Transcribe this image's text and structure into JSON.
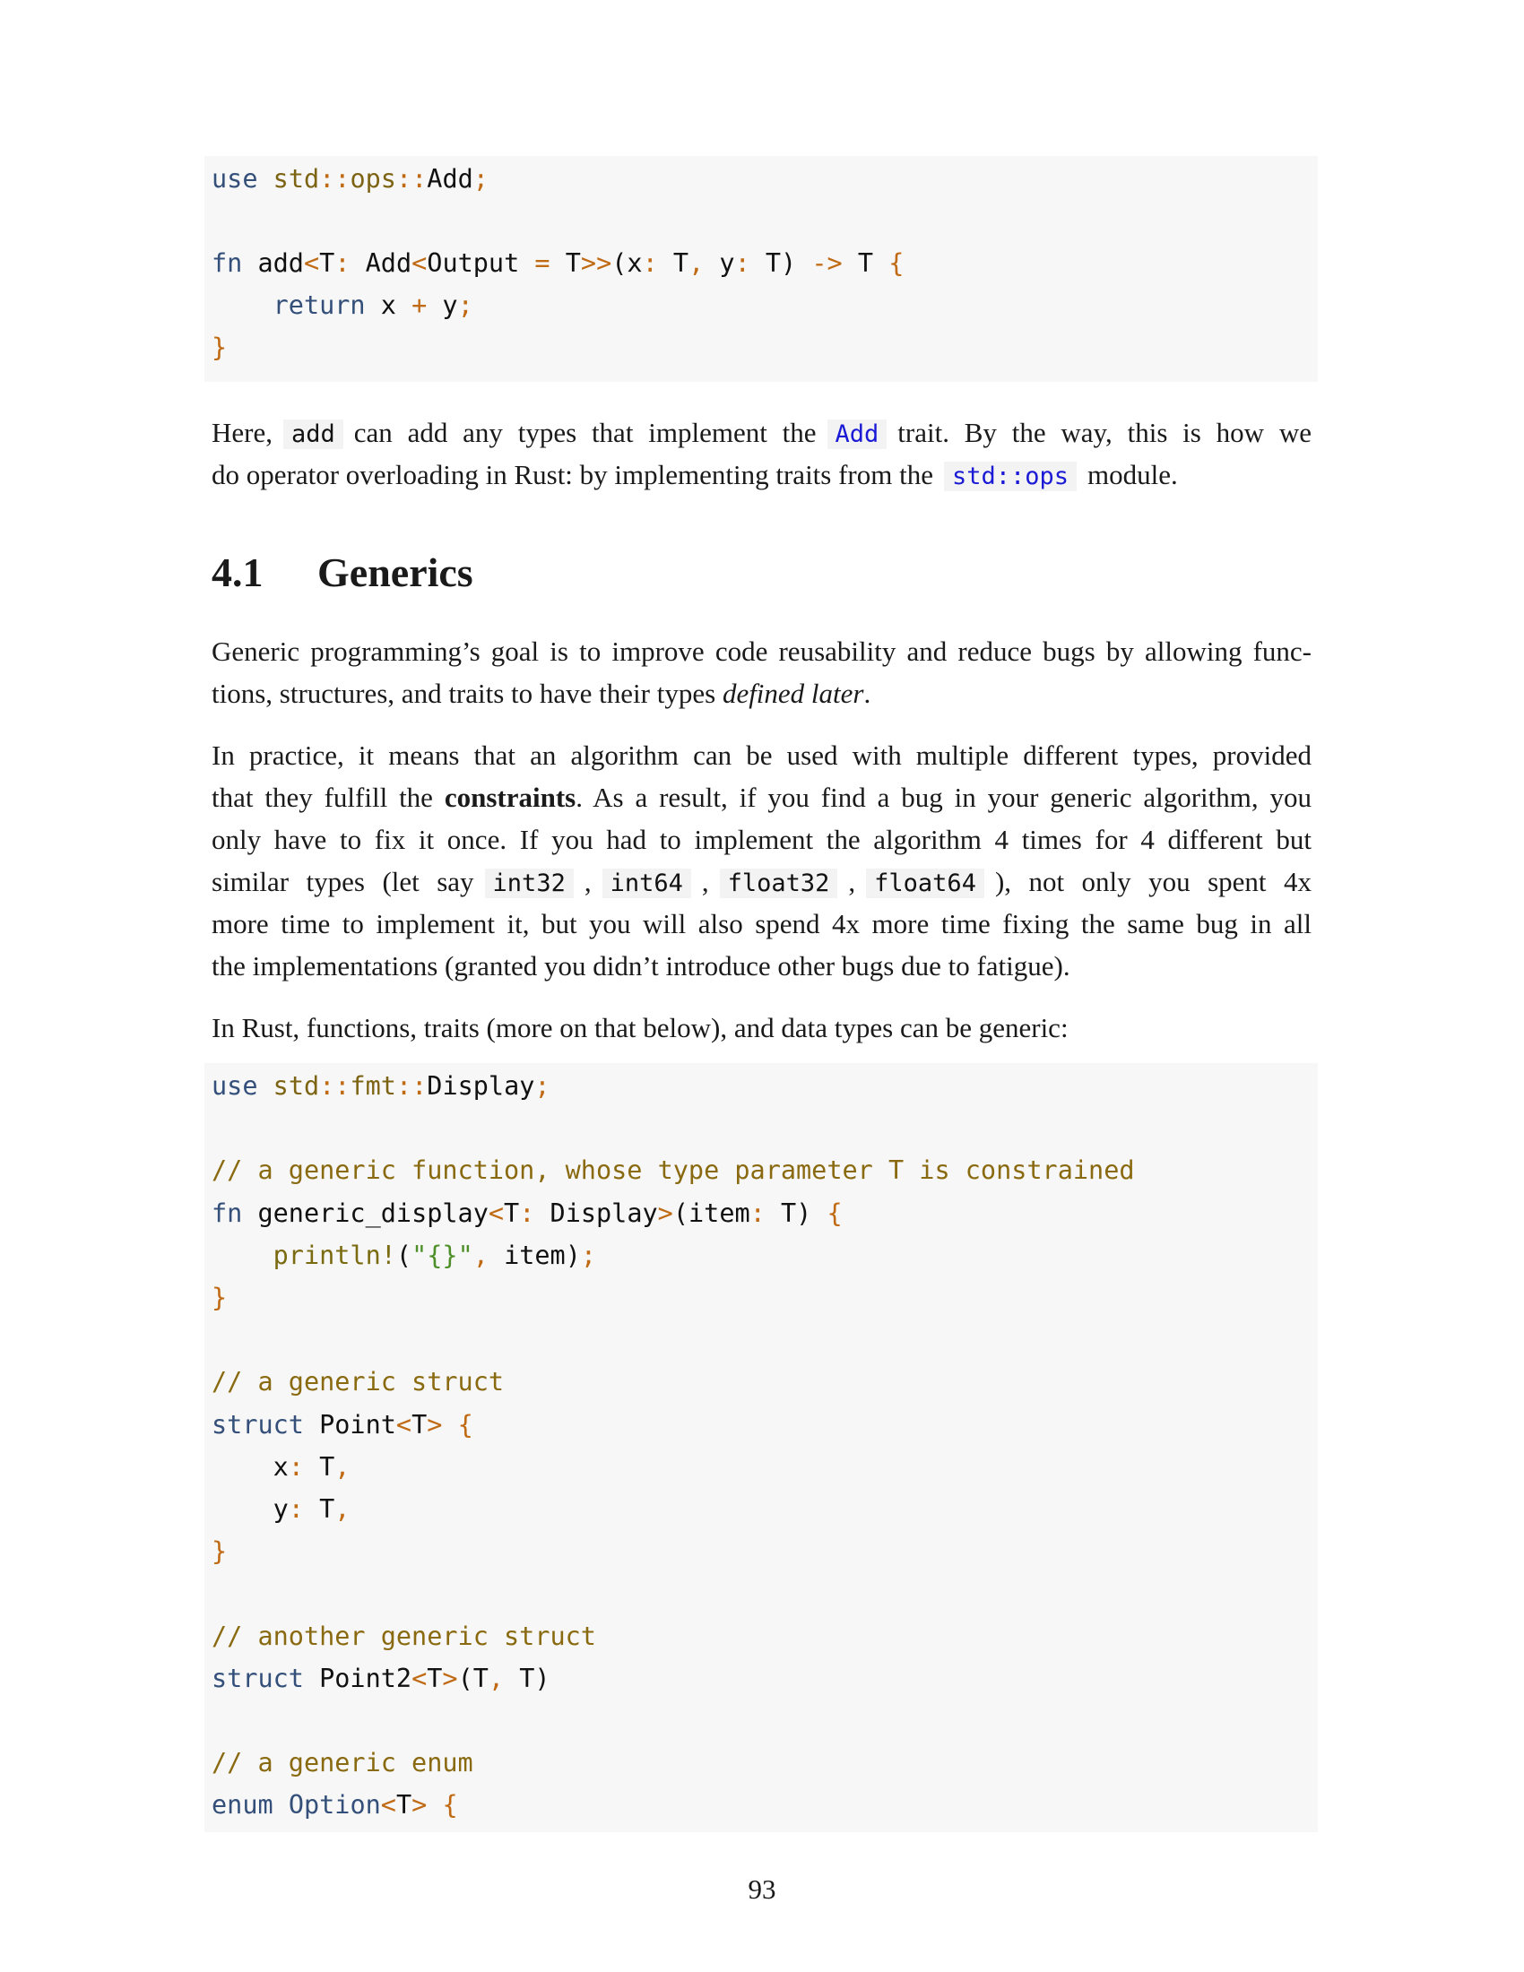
{
  "code_block_1": {
    "lines": [
      [
        {
          "t": "use",
          "c": "k"
        },
        {
          "t": " "
        },
        {
          "t": "std",
          "c": "m"
        },
        {
          "t": "::",
          "c": "p"
        },
        {
          "t": "ops",
          "c": "m"
        },
        {
          "t": "::",
          "c": "p"
        },
        {
          "t": "Add"
        },
        {
          "t": ";",
          "c": "p"
        }
      ],
      [],
      [
        {
          "t": "fn",
          "c": "k"
        },
        {
          "t": " add"
        },
        {
          "t": "<",
          "c": "p"
        },
        {
          "t": "T"
        },
        {
          "t": ":",
          "c": "p"
        },
        {
          "t": " Add"
        },
        {
          "t": "<",
          "c": "p"
        },
        {
          "t": "Output "
        },
        {
          "t": "=",
          "c": "p"
        },
        {
          "t": " T"
        },
        {
          "t": ">>",
          "c": "p"
        },
        {
          "t": "(x"
        },
        {
          "t": ":",
          "c": "p"
        },
        {
          "t": " T"
        },
        {
          "t": ",",
          "c": "p"
        },
        {
          "t": " y"
        },
        {
          "t": ":",
          "c": "p"
        },
        {
          "t": " T) "
        },
        {
          "t": "->",
          "c": "p"
        },
        {
          "t": " T "
        },
        {
          "t": "{",
          "c": "p"
        }
      ],
      [
        {
          "t": "    "
        },
        {
          "t": "return",
          "c": "k"
        },
        {
          "t": " x "
        },
        {
          "t": "+",
          "c": "p"
        },
        {
          "t": " y"
        },
        {
          "t": ";",
          "c": "p"
        }
      ],
      [
        {
          "t": "}",
          "c": "p"
        }
      ]
    ]
  },
  "para_1": {
    "here": "Here,",
    "code_add": "add",
    "mid": "can add any types that implement the",
    "code_Add": "Add",
    "tail": "trait. By the way, this is how we",
    "line2_start": "do operator overloading in Rust: by implementing traits from the",
    "code_ops": "std::ops",
    "line2_end": "module."
  },
  "section": {
    "number": "4.1",
    "title": "Generics"
  },
  "para_2": {
    "line1": "Generic programming’s goal is to improve code reusability and reduce bugs by allowing func-",
    "line2_start": "tions, structures, and traits to have their types",
    "line2_em": "defined later",
    "line2_end": "."
  },
  "para_3": {
    "line1": "In practice, it means that an algorithm can be used with multiple different types, provided",
    "line2_start": "that they fulfill the",
    "line2_bold": "constraints",
    "line2_end": ". As a result, if you find a bug in your generic algorithm, you",
    "line3": "only have to fix it once. If you had to implement the algorithm 4 times for 4 different but",
    "line4_start": "similar types (let say",
    "code_int32": "int32",
    "code_int64": "int64",
    "code_float32": "float32",
    "code_float64": "float64",
    "comma": ",",
    "line4_end": "), not only you spent 4x",
    "line5": "more time to implement it, but you will also spend 4x more time fixing the same bug in all",
    "line6": "the implementations (granted you didn’t introduce other bugs due to fatigue)."
  },
  "para_4": "In Rust, functions, traits (more on that below), and data types can be generic:",
  "code_block_2": {
    "lines": [
      [
        {
          "t": "use",
          "c": "k"
        },
        {
          "t": " "
        },
        {
          "t": "std",
          "c": "m"
        },
        {
          "t": "::",
          "c": "p"
        },
        {
          "t": "fmt",
          "c": "m"
        },
        {
          "t": "::",
          "c": "p"
        },
        {
          "t": "Display"
        },
        {
          "t": ";",
          "c": "p"
        }
      ],
      [],
      [
        {
          "t": "// a generic function, whose type parameter T is constrained",
          "c": "c"
        }
      ],
      [
        {
          "t": "fn",
          "c": "k"
        },
        {
          "t": " generic_display"
        },
        {
          "t": "<",
          "c": "p"
        },
        {
          "t": "T"
        },
        {
          "t": ":",
          "c": "p"
        },
        {
          "t": " Display"
        },
        {
          "t": ">",
          "c": "p"
        },
        {
          "t": "(item"
        },
        {
          "t": ":",
          "c": "p"
        },
        {
          "t": " T) "
        },
        {
          "t": "{",
          "c": "p"
        }
      ],
      [
        {
          "t": "    "
        },
        {
          "t": "println!",
          "c": "f"
        },
        {
          "t": "("
        },
        {
          "t": "\"{}\"",
          "c": "s"
        },
        {
          "t": ",",
          "c": "p"
        },
        {
          "t": " item)"
        },
        {
          "t": ";",
          "c": "p"
        }
      ],
      [
        {
          "t": "}",
          "c": "p"
        }
      ],
      [],
      [
        {
          "t": "// a generic struct",
          "c": "c"
        }
      ],
      [
        {
          "t": "struct",
          "c": "k"
        },
        {
          "t": " Point"
        },
        {
          "t": "<",
          "c": "p"
        },
        {
          "t": "T"
        },
        {
          "t": ">",
          "c": "p"
        },
        {
          "t": " "
        },
        {
          "t": "{",
          "c": "p"
        }
      ],
      [
        {
          "t": "    x"
        },
        {
          "t": ":",
          "c": "p"
        },
        {
          "t": " T"
        },
        {
          "t": ",",
          "c": "p"
        }
      ],
      [
        {
          "t": "    y"
        },
        {
          "t": ":",
          "c": "p"
        },
        {
          "t": " T"
        },
        {
          "t": ",",
          "c": "p"
        }
      ],
      [
        {
          "t": "}",
          "c": "p"
        }
      ],
      [],
      [
        {
          "t": "// another generic struct",
          "c": "c"
        }
      ],
      [
        {
          "t": "struct",
          "c": "k"
        },
        {
          "t": " Point2"
        },
        {
          "t": "<",
          "c": "p"
        },
        {
          "t": "T"
        },
        {
          "t": ">",
          "c": "p"
        },
        {
          "t": "(T"
        },
        {
          "t": ",",
          "c": "p"
        },
        {
          "t": " T)"
        }
      ],
      [],
      [
        {
          "t": "// a generic enum",
          "c": "c"
        }
      ],
      [
        {
          "t": "enum",
          "c": "k"
        },
        {
          "t": " "
        },
        {
          "t": "Option",
          "c": "k"
        },
        {
          "t": "<",
          "c": "p"
        },
        {
          "t": "T"
        },
        {
          "t": ">",
          "c": "p"
        },
        {
          "t": " "
        },
        {
          "t": "{",
          "c": "p"
        }
      ]
    ]
  },
  "page_number": "93"
}
